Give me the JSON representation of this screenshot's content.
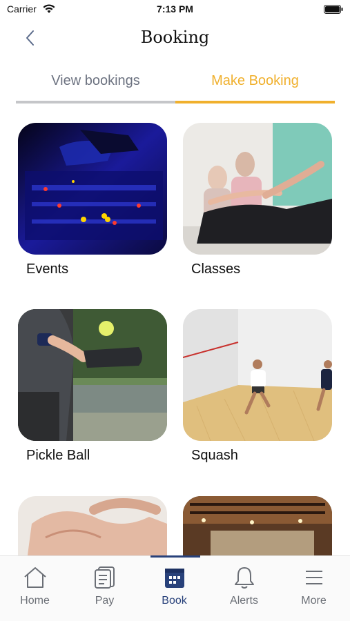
{
  "status": {
    "carrier": "Carrier",
    "time": "7:13 PM"
  },
  "nav": {
    "title": "Booking"
  },
  "tabs": {
    "left": "View bookings",
    "right": "Make Booking"
  },
  "cards": [
    {
      "label": "Events"
    },
    {
      "label": "Classes"
    },
    {
      "label": "Pickle Ball"
    },
    {
      "label": "Squash"
    },
    {
      "label": ""
    },
    {
      "label": ""
    }
  ],
  "tabbar": {
    "items": [
      {
        "label": "Home"
      },
      {
        "label": "Pay"
      },
      {
        "label": "Book"
      },
      {
        "label": "Alerts"
      },
      {
        "label": "More"
      }
    ]
  },
  "colors": {
    "accent": "#f0b02d",
    "brand": "#28417a",
    "inactive": "#6b6f76"
  }
}
